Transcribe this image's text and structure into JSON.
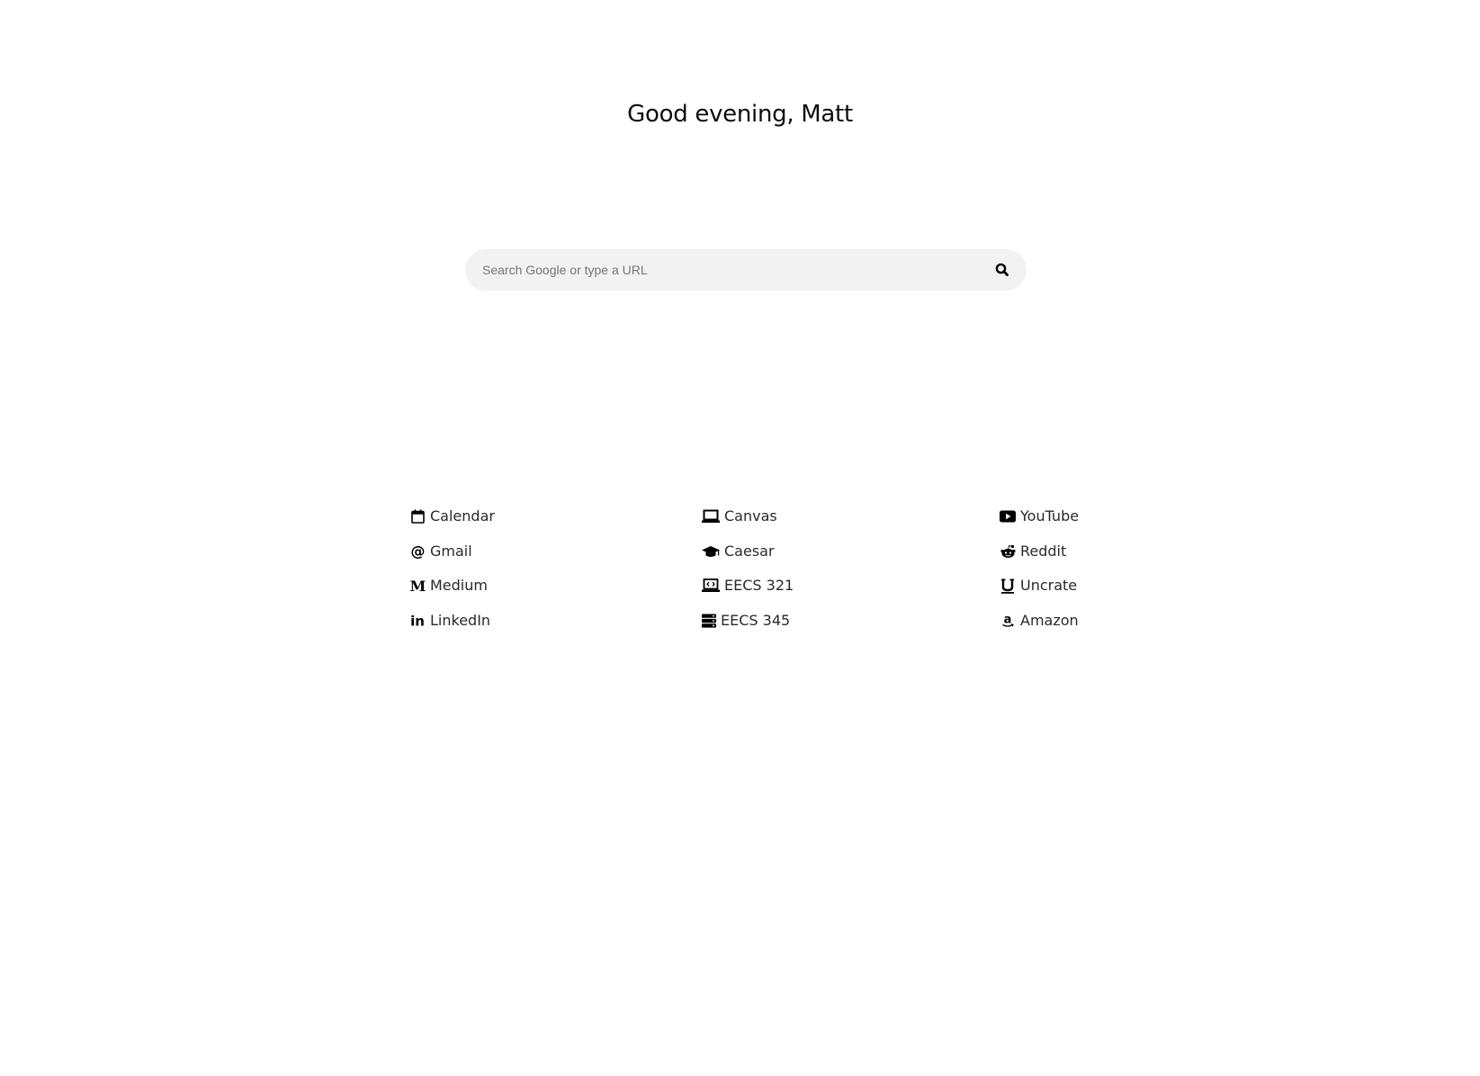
{
  "greeting": "Good evening, Matt",
  "search": {
    "placeholder": "Search Google or type a URL",
    "value": ""
  },
  "links": {
    "col1": [
      {
        "label": "Calendar",
        "icon": "calendar-icon"
      },
      {
        "label": "Gmail",
        "icon": "at-icon"
      },
      {
        "label": "Medium",
        "icon": "medium-icon"
      },
      {
        "label": "LinkedIn",
        "icon": "linkedin-icon"
      }
    ],
    "col2": [
      {
        "label": "Canvas",
        "icon": "laptop-icon"
      },
      {
        "label": "Caesar",
        "icon": "graduation-cap-icon"
      },
      {
        "label": "EECS 321",
        "icon": "code-laptop-icon"
      },
      {
        "label": "EECS 345",
        "icon": "server-icon"
      }
    ],
    "col3": [
      {
        "label": "YouTube",
        "icon": "youtube-icon"
      },
      {
        "label": "Reddit",
        "icon": "reddit-icon"
      },
      {
        "label": "Uncrate",
        "icon": "uncrate-icon"
      },
      {
        "label": "Amazon",
        "icon": "amazon-icon"
      }
    ]
  },
  "colors": {
    "background": "#ffffff",
    "search_bg": "#f2f2f2",
    "text": "#2a2a2a"
  }
}
